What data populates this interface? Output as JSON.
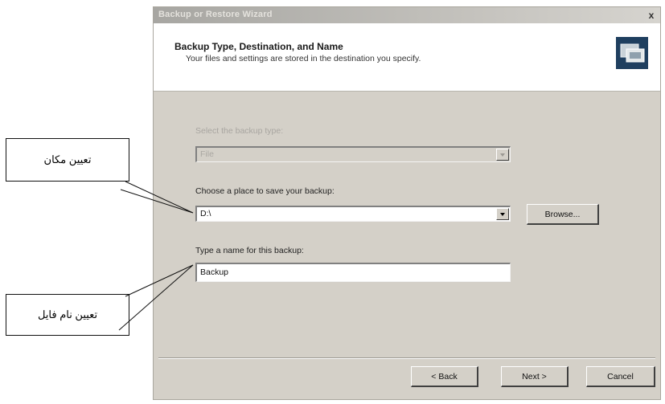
{
  "window": {
    "title": "Backup or Restore Wizard",
    "close_glyph": "x"
  },
  "header": {
    "title": "Backup Type, Destination, and Name",
    "subtitle": "Your files and settings are stored in the destination you specify.",
    "icon": "backup-wizard-icon"
  },
  "form": {
    "backup_type_label": "Select the backup type:",
    "backup_type_value": "File",
    "destination_label": "Choose a place to save your backup:",
    "destination_value": "D:\\",
    "browse_label": "Browse...",
    "name_label": "Type a name for this backup:",
    "name_value": "Backup"
  },
  "footer": {
    "back_label": "< Back",
    "next_label": "Next >",
    "cancel_label": "Cancel"
  },
  "annotations": {
    "location_label": "تعیین مکان",
    "filename_label": "تعیین نام فایل"
  }
}
